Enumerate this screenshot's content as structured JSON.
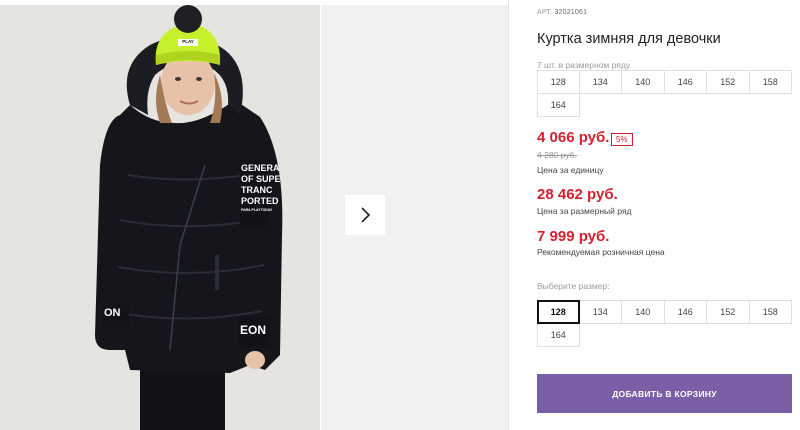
{
  "product": {
    "art_label": "АРТ.",
    "art_number": "32021061",
    "title": "Куртка зимняя для девочки",
    "sizes_note": "7 шт. в размерном ряду",
    "size_row": [
      "128",
      "134",
      "140",
      "146",
      "152",
      "158",
      "164"
    ],
    "price": "4 066 руб.",
    "discount": "5%",
    "old_price": "4 280 руб.",
    "price_caption": "Цена за единицу",
    "set_price": "28 462 руб.",
    "set_caption": "Цена за размерный ряд",
    "retail_price": "7 999 руб.",
    "retail_caption": "Рекомендуемая розничная цена",
    "choose_label": "Выберите размер:",
    "choose_sizes": [
      "128",
      "134",
      "140",
      "146",
      "152",
      "158",
      "164"
    ],
    "selected_size": "128",
    "cart_button": "ДОБАВИТЬ В КОРЗИНУ"
  },
  "photo": {
    "sleeve_text": [
      "GENERA",
      "OF SUPE",
      "TRANC",
      "PORTED",
      "PARA PLAYTODAY"
    ],
    "hat_tag": "PLAY",
    "cuff_left": "ON",
    "cuff_right": "EON"
  },
  "colors": {
    "price_red": "#d62030",
    "button_purple": "#7b5fa6",
    "jacket": "#14161c",
    "hat": "#c5f02c"
  },
  "icons": {
    "next": "chevron-right-icon"
  }
}
